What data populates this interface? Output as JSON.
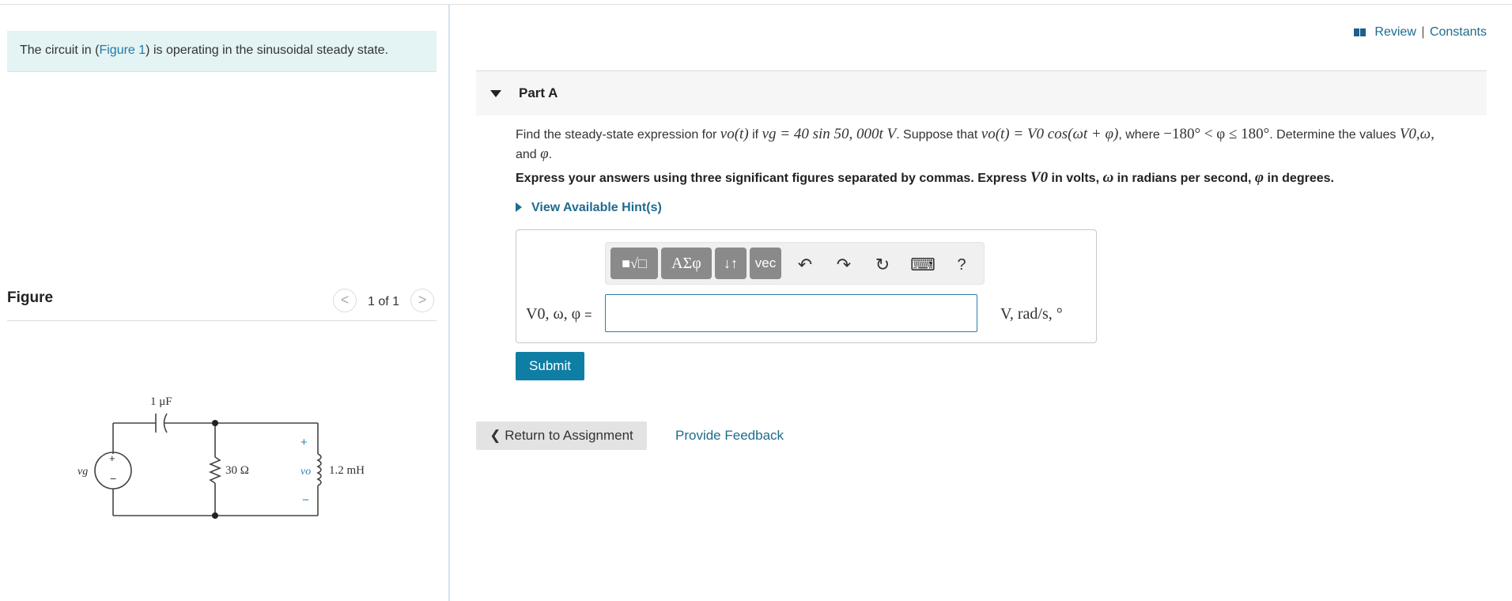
{
  "intro": {
    "prefix": "The circuit in (",
    "link": "Figure 1",
    "suffix": ") is operating in the sinusoidal steady state."
  },
  "figure": {
    "title": "Figure",
    "page_indicator": "1 of 1",
    "prev_symbol": "<",
    "next_symbol": ">",
    "circuit": {
      "capacitor_label": "1 μF",
      "resistor_label": "30 Ω",
      "inductor_label": "1.2 mH",
      "source_label": "vg",
      "output_label": "vo",
      "plus": "+",
      "minus": "−"
    }
  },
  "header": {
    "review": "Review",
    "separator": "|",
    "constants": "Constants"
  },
  "part": {
    "title": "Part A"
  },
  "question": {
    "t1": "Find the steady-state expression for ",
    "m1": "vo(t)",
    "t2": " if ",
    "m2": "vg = 40 sin 50, 000t V",
    "t3": ". Suppose that ",
    "m3": "vo(t) = V0 cos(ωt + φ)",
    "t4": ", where ",
    "m4": "−180° < φ ≤ 180°",
    "t5": ". Determine the values ",
    "m5": "V0,ω,",
    "t6": "and ",
    "m6": "φ",
    "t7": "."
  },
  "instructions": {
    "a": "Express your answers using three significant figures separated by commas. Express ",
    "b": "V0",
    "c": " in volts, ",
    "d": "ω",
    "e": " in radians per second, ",
    "f": "φ",
    "g": " in degrees."
  },
  "hint": {
    "label": "View Available Hint(s)"
  },
  "toolbar": {
    "templates": "■√□",
    "greek": "ΑΣφ",
    "arrows": "↓↑",
    "vec": "vec",
    "undo": "↶",
    "redo": "↷",
    "reset": "↻",
    "keyboard": "⌨",
    "help": "?"
  },
  "answer": {
    "label": "V0, ω, φ",
    "equals": "=",
    "value": "",
    "units": "V, rad/s, °"
  },
  "buttons": {
    "submit": "Submit",
    "return": "Return to Assignment",
    "return_icon": "❮",
    "feedback": "Provide Feedback"
  }
}
